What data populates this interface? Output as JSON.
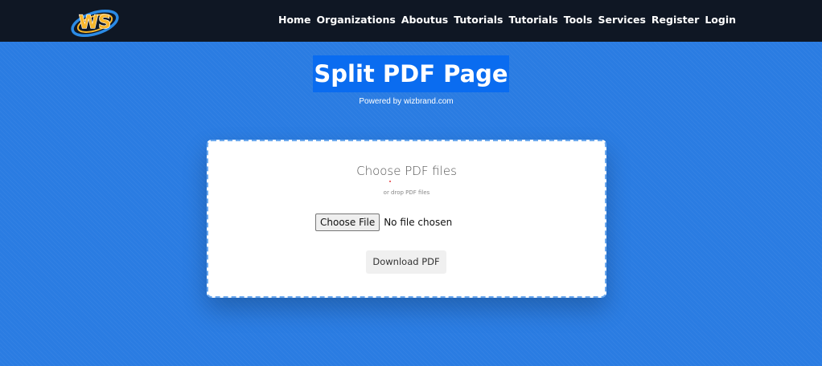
{
  "brand": {
    "logo_text": "WS",
    "colors": {
      "logo_gold": "#f7b52b",
      "logo_blue": "#2b8be6",
      "navbar_bg": "#0f1724",
      "page_bg": "#2a7ce2",
      "title_highlight": "#0a6cf0"
    }
  },
  "nav": {
    "items": [
      {
        "label": "Home"
      },
      {
        "label": "Organizations"
      },
      {
        "label": "Aboutus"
      },
      {
        "label": "Tutorials"
      },
      {
        "label": "Tutorials"
      },
      {
        "label": "Tools"
      },
      {
        "label": "Services"
      },
      {
        "label": "Register"
      },
      {
        "label": "Login"
      }
    ]
  },
  "hero": {
    "title": "Split PDF Page",
    "subtitle": "Powered by wizbrand.com"
  },
  "upload": {
    "heading": "Choose PDF files",
    "drop_hint": "or drop PDF files",
    "choose_file_label": "Choose File",
    "file_status": "No file chosen",
    "download_label": "Download PDF"
  }
}
